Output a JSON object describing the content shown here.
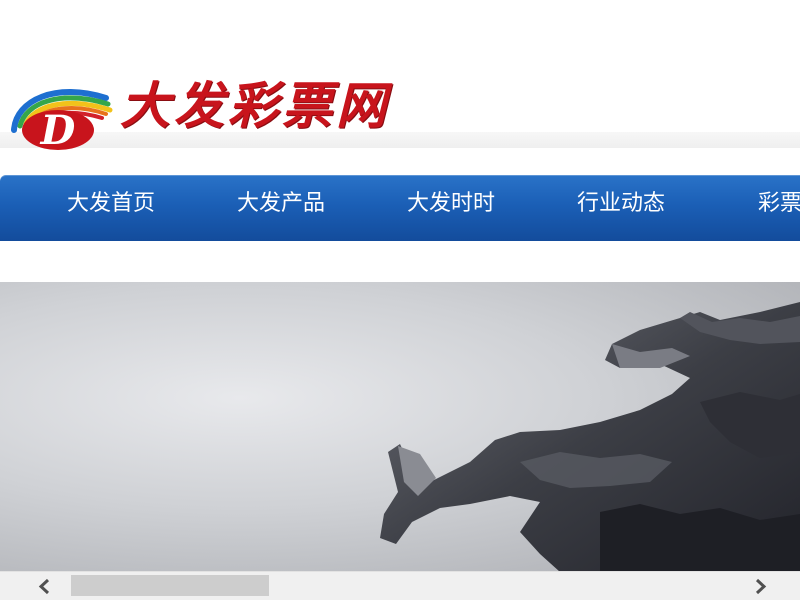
{
  "site": {
    "logo_text": "大发彩票网",
    "logo_letter": "D"
  },
  "nav": {
    "items": [
      {
        "label": "大发首页"
      },
      {
        "label": "大发产品"
      },
      {
        "label": "大发时时"
      },
      {
        "label": "行业动态"
      },
      {
        "label": "彩票资"
      }
    ]
  },
  "colors": {
    "nav_blue": "#1b5fb6",
    "logo_red": "#c8141c"
  },
  "banner": {
    "subject": "dragon-sculpture"
  },
  "scrollbar": {
    "left_icon": "chevron-left-icon",
    "right_icon": "chevron-right-icon"
  }
}
